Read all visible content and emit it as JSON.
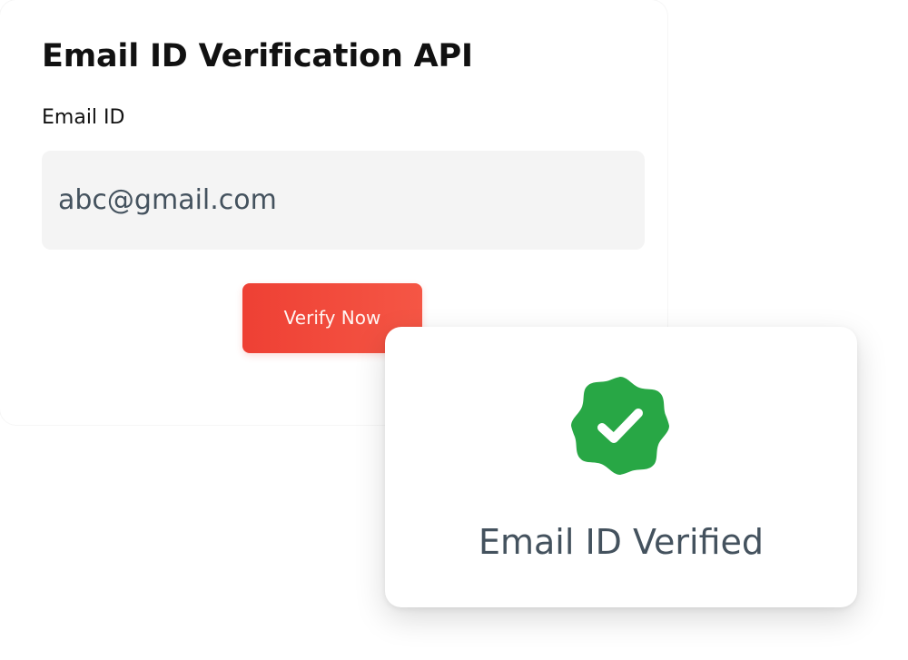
{
  "form": {
    "title": "Email ID Verification API",
    "email_label": "Email ID",
    "email_value": "abc@gmail.com",
    "verify_label": "Verify Now"
  },
  "result": {
    "icon": "verified-badge-icon",
    "message": "Email ID Verified"
  },
  "colors": {
    "accent": "#EE4034",
    "success": "#28A745",
    "text": "#111111",
    "muted_text": "#44525E",
    "input_bg": "#F4F4F4"
  }
}
